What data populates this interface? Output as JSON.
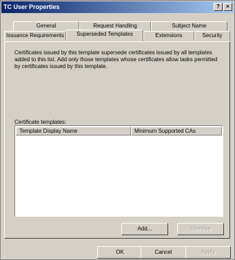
{
  "window": {
    "title": "TC User Properties",
    "help_glyph": "?",
    "close_glyph": "×"
  },
  "tabs": {
    "row1": [
      "General",
      "Request Handling",
      "Subject Name"
    ],
    "row2": [
      "Issuance Requirements",
      "Superseded Templates",
      "Extensions",
      "Security"
    ],
    "active": "Superseded Templates"
  },
  "panel": {
    "description": "Certificates issued by this template supersede certificates issued by all templates added to this list. Add only those templates whose certificates allow tasks permitted by certificates issued by this template.",
    "list_label": "Certificate templates:",
    "columns": [
      "Template Display Name",
      "Minimum Supported CAs"
    ],
    "add_label": "Add...",
    "remove_label": "Remove"
  },
  "footer": {
    "ok_label": "OK",
    "cancel_label": "Cancel",
    "apply_label": "Apply"
  }
}
